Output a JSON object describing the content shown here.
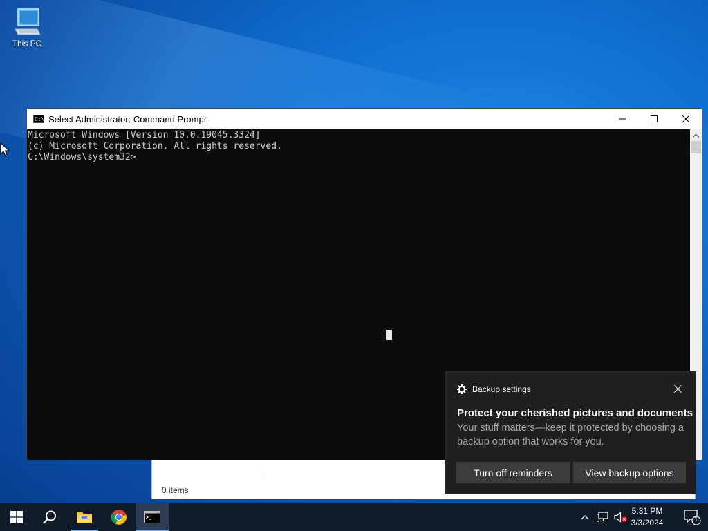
{
  "desktop": {
    "icons": [
      {
        "label": "This PC",
        "icon": "this-pc-icon"
      }
    ]
  },
  "background_window": {
    "status_text": "0 items"
  },
  "cmd_window": {
    "title": "Select Administrator: Command Prompt",
    "lines": [
      "Microsoft Windows [Version 10.0.19045.3324]",
      "(c) Microsoft Corporation. All rights reserved.",
      "",
      "C:\\Windows\\system32>"
    ]
  },
  "toast": {
    "app_name": "Backup settings",
    "heading": "Protect your cherished pictures and documents",
    "body": "Your stuff matters—keep it protected by choosing a backup option that works for you.",
    "buttons": {
      "turn_off": "Turn off reminders",
      "view_options": "View backup options"
    }
  },
  "taskbar": {
    "items": [
      "start-icon",
      "search-icon",
      "file-explorer-icon",
      "chrome-icon",
      "command-prompt-icon"
    ],
    "clock": {
      "time": "5:31 PM",
      "date": "3/3/2024"
    },
    "notification_count": "1"
  },
  "colors": {
    "taskbar_bg": "#101b2a",
    "console_bg": "#0c0c0c",
    "console_text": "#cccccc",
    "toast_bg": "#1f1f1f",
    "toast_button": "#3b3b3b"
  }
}
